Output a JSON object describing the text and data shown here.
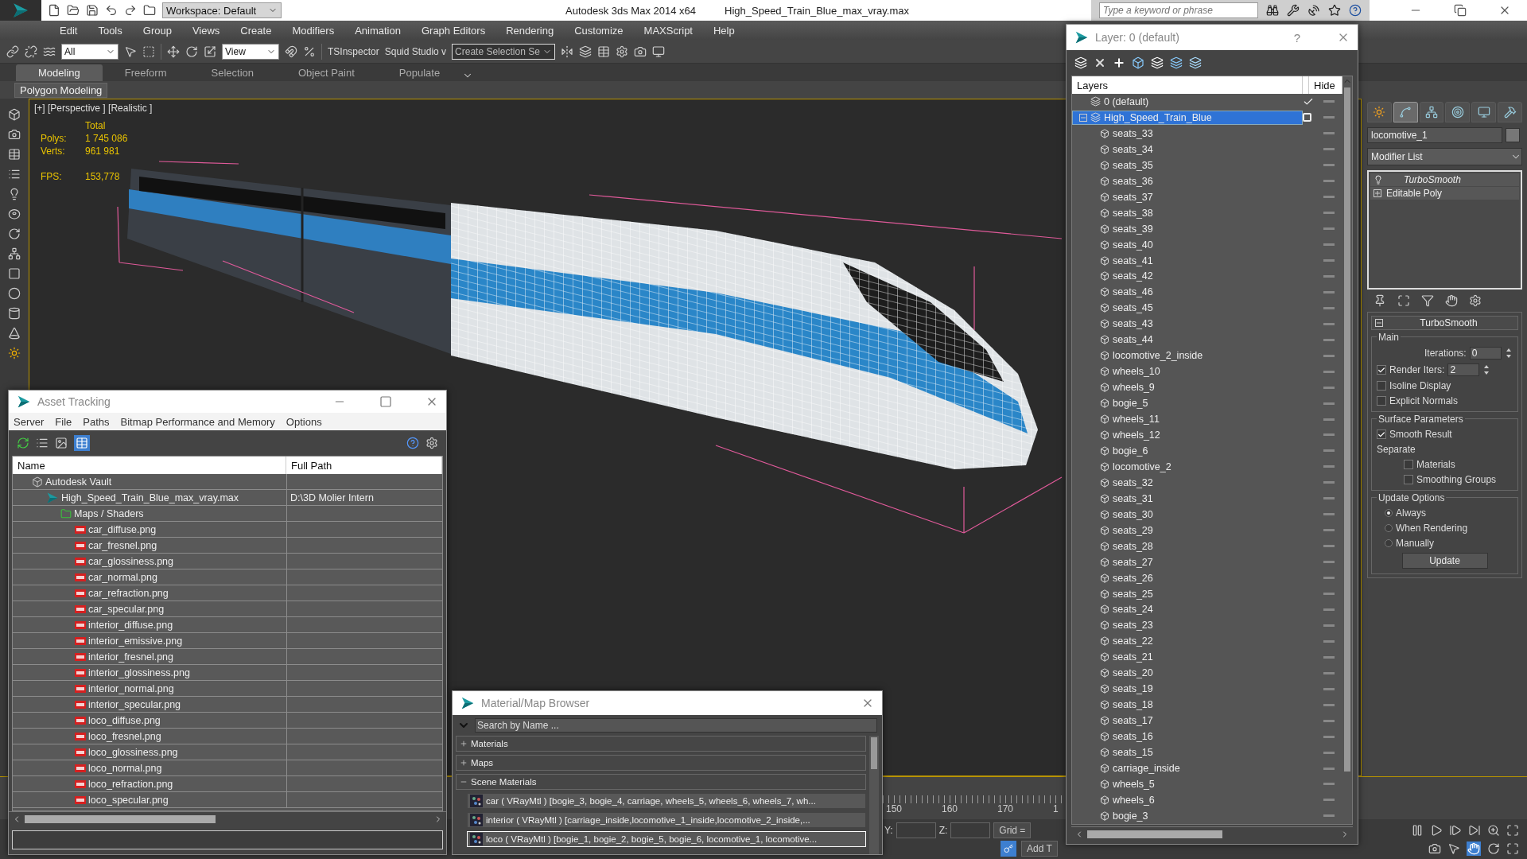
{
  "title_bar": {
    "workspace": "Workspace: Default",
    "app_title": "Autodesk 3ds Max  2014 x64",
    "file_name": "High_Speed_Train_Blue_max_vray.max",
    "search": {
      "placeholder": "Type a keyword or phrase"
    }
  },
  "menu": [
    "Edit",
    "Tools",
    "Group",
    "Views",
    "Create",
    "Modifiers",
    "Animation",
    "Graph Editors",
    "Rendering",
    "Customize",
    "MAXScript",
    "Help"
  ],
  "toolbar": {
    "selection_filter": "All",
    "reference_system": "View",
    "plugins": [
      "TSInspector",
      "Squid Studio v"
    ],
    "selection_set": "Create Selection Se"
  },
  "ribbon": {
    "tabs": [
      {
        "label": "Modeling",
        "selected": true
      },
      {
        "label": "Freeform",
        "selected": false
      },
      {
        "label": "Selection",
        "selected": false
      },
      {
        "label": "Object Paint",
        "selected": false
      },
      {
        "label": "Populate",
        "selected": false
      }
    ],
    "panel": "Polygon Modeling"
  },
  "viewport": {
    "label": "[+] [Perspective ] [Realistic ]",
    "stats_header": "Total",
    "stats": [
      {
        "label": "Polys:",
        "value": "1 745 086"
      },
      {
        "label": "Verts:",
        "value": "961 981"
      },
      {
        "label": "FPS:",
        "value": "153,778"
      }
    ]
  },
  "timeline": {
    "ticks": [
      "150",
      "160",
      "170",
      "1"
    ]
  },
  "status_bar": {
    "coords": [
      {
        "label": "Y:"
      },
      {
        "label": "Z:"
      }
    ],
    "grid": "Grid =",
    "add_time_tag": "Add T"
  },
  "asset_tracking": {
    "title": "Asset Tracking",
    "menu": [
      "Server",
      "File",
      "Paths",
      "Bitmap Performance and Memory",
      "Options"
    ],
    "columns": [
      "Name",
      "Full Path"
    ],
    "rows": [
      {
        "kind": "vault",
        "name": "Autodesk Vault",
        "children": [
          {
            "kind": "scene",
            "name": "High_Speed_Train_Blue_max_vray.max",
            "path": "D:\\3D Molier Intern",
            "children": [
              {
                "kind": "folder",
                "name": "Maps / Shaders",
                "children": [
                  {
                    "kind": "image",
                    "name": "car_diffuse.png"
                  },
                  {
                    "kind": "image",
                    "name": "car_fresnel.png"
                  },
                  {
                    "kind": "image",
                    "name": "car_glossiness.png"
                  },
                  {
                    "kind": "image",
                    "name": "car_normal.png"
                  },
                  {
                    "kind": "image",
                    "name": "car_refraction.png"
                  },
                  {
                    "kind": "image",
                    "name": "car_specular.png"
                  },
                  {
                    "kind": "image",
                    "name": "interior_diffuse.png"
                  },
                  {
                    "kind": "image",
                    "name": "interior_emissive.png"
                  },
                  {
                    "kind": "image",
                    "name": "interior_fresnel.png"
                  },
                  {
                    "kind": "image",
                    "name": "interior_glossiness.png"
                  },
                  {
                    "kind": "image",
                    "name": "interior_normal.png"
                  },
                  {
                    "kind": "image",
                    "name": "interior_specular.png"
                  },
                  {
                    "kind": "image",
                    "name": "loco_diffuse.png"
                  },
                  {
                    "kind": "image",
                    "name": "loco_fresnel.png"
                  },
                  {
                    "kind": "image",
                    "name": "loco_glossiness.png"
                  },
                  {
                    "kind": "image",
                    "name": "loco_normal.png"
                  },
                  {
                    "kind": "image",
                    "name": "loco_refraction.png"
                  },
                  {
                    "kind": "image",
                    "name": "loco_specular.png"
                  }
                ]
              }
            ]
          }
        ]
      }
    ]
  },
  "material_browser": {
    "title": "Material/Map Browser",
    "search": {
      "placeholder": "Search by Name ..."
    },
    "groups": [
      {
        "label": "Materials",
        "expanded": false
      },
      {
        "label": "Maps",
        "expanded": false
      },
      {
        "label": "Scene Materials",
        "expanded": true,
        "items": [
          {
            "text": "car  ( VRayMtl ) [bogie_3, bogie_4, carriage, wheels_5, wheels_6, wheels_7, wh...",
            "selected": false
          },
          {
            "text": "interior ( VRayMtl ) [carriage_inside,locomotive_1_inside,locomotive_2_inside,...",
            "selected": false
          },
          {
            "text": "loco ( VRayMtl ) [bogie_1, bogie_2, bogie_5, bogie_6, locomotive_1, locomotive...",
            "selected": true
          }
        ]
      }
    ]
  },
  "layer_manager": {
    "title": "Layer: 0 (default)",
    "help_button": "?",
    "columns": [
      "Layers",
      "Hide"
    ],
    "layers": [
      {
        "name": "0 (default)",
        "current": true,
        "selected": false
      },
      {
        "name": "High_Speed_Train_Blue",
        "current": false,
        "selected": true,
        "expanded": true,
        "children": [
          {
            "name": "seats_33",
            "selected": false
          },
          {
            "name": "seats_34",
            "selected": false
          },
          {
            "name": "seats_35",
            "selected": false
          },
          {
            "name": "seats_36",
            "selected": false
          },
          {
            "name": "seats_37",
            "selected": false
          },
          {
            "name": "seats_38",
            "selected": false
          },
          {
            "name": "seats_39",
            "selected": false
          },
          {
            "name": "seats_40",
            "selected": false
          },
          {
            "name": "seats_41",
            "selected": false
          },
          {
            "name": "seats_42",
            "selected": false
          },
          {
            "name": "seats_46",
            "selected": false
          },
          {
            "name": "seats_45",
            "selected": false
          },
          {
            "name": "seats_43",
            "selected": false
          },
          {
            "name": "seats_44",
            "selected": false
          },
          {
            "name": "locomotive_2_inside",
            "selected": false
          },
          {
            "name": "wheels_10",
            "selected": false
          },
          {
            "name": "wheels_9",
            "selected": false
          },
          {
            "name": "bogie_5",
            "selected": false
          },
          {
            "name": "wheels_11",
            "selected": false
          },
          {
            "name": "wheels_12",
            "selected": false
          },
          {
            "name": "bogie_6",
            "selected": false
          },
          {
            "name": "locomotive_2",
            "selected": false
          },
          {
            "name": "seats_32",
            "selected": false
          },
          {
            "name": "seats_31",
            "selected": false
          },
          {
            "name": "seats_30",
            "selected": false
          },
          {
            "name": "seats_29",
            "selected": false
          },
          {
            "name": "seats_28",
            "selected": false
          },
          {
            "name": "seats_27",
            "selected": false
          },
          {
            "name": "seats_26",
            "selected": false
          },
          {
            "name": "seats_25",
            "selected": false
          },
          {
            "name": "seats_24",
            "selected": false
          },
          {
            "name": "seats_23",
            "selected": false
          },
          {
            "name": "seats_22",
            "selected": false
          },
          {
            "name": "seats_21",
            "selected": false
          },
          {
            "name": "seats_20",
            "selected": false
          },
          {
            "name": "seats_19",
            "selected": false
          },
          {
            "name": "seats_18",
            "selected": false
          },
          {
            "name": "seats_17",
            "selected": false
          },
          {
            "name": "seats_16",
            "selected": false
          },
          {
            "name": "seats_15",
            "selected": false
          },
          {
            "name": "carriage_inside",
            "selected": false
          },
          {
            "name": "wheels_5",
            "selected": false
          },
          {
            "name": "wheels_6",
            "selected": false
          },
          {
            "name": "bogie_3",
            "selected": false
          }
        ]
      }
    ]
  },
  "command_panel": {
    "tabs": [
      {
        "kind": "create",
        "selected": false
      },
      {
        "kind": "modify",
        "selected": true
      },
      {
        "kind": "hierarchy",
        "selected": false
      },
      {
        "kind": "motion",
        "selected": false
      },
      {
        "kind": "display",
        "selected": false
      },
      {
        "kind": "utilities",
        "selected": false
      }
    ],
    "object_name": "locomotive_1",
    "modifier_list": "Modifier List",
    "stack": [
      {
        "kind": "modifier",
        "name": "TurboSmooth"
      },
      {
        "kind": "base",
        "name": "Editable Poly"
      }
    ],
    "rollout": {
      "title": "TurboSmooth",
      "expanded": true,
      "main": {
        "label": "Main",
        "iterations": {
          "label": "Iterations:",
          "value": "0"
        },
        "render_iters": {
          "label": "Render Iters:",
          "checked": true,
          "value": "2"
        },
        "options": [
          {
            "label": "Isoline Display",
            "checked": false
          },
          {
            "label": "Explicit Normals",
            "checked": false
          }
        ]
      },
      "surface": {
        "label": "Surface Parameters",
        "smooth_result": {
          "label": "Smooth Result",
          "checked": true
        },
        "separate": "Separate",
        "options": [
          {
            "label": "Materials",
            "checked": false
          },
          {
            "label": "Smoothing Groups",
            "checked": false
          }
        ]
      },
      "update": {
        "label": "Update Options",
        "options": [
          {
            "label": "Always",
            "selected": true
          },
          {
            "label": "When Rendering",
            "selected": false
          },
          {
            "label": "Manually",
            "selected": false
          }
        ],
        "button": "Update"
      }
    }
  }
}
